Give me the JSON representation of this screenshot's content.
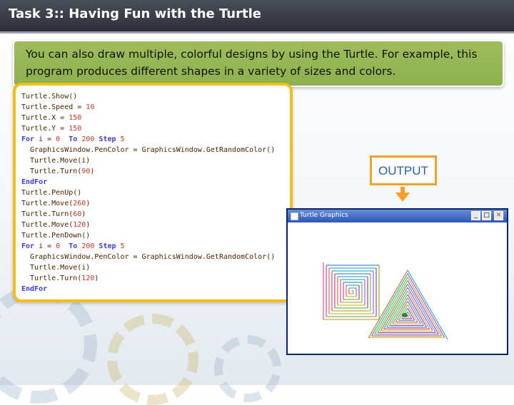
{
  "slide": {
    "title": "Task 3:: Having Fun with the Turtle",
    "instruction": "You can also draw multiple, colorful designs by using the Turtle.  For example, this program produces different shapes in a variety of sizes and colors."
  },
  "code": {
    "lines": [
      "Turtle.Show()",
      "Turtle.Speed = 10",
      "Turtle.X = 150",
      "Turtle.Y = 150",
      "For i = 0  To 200 Step 5",
      "  GraphicsWindow.PenColor = GraphicsWindow.GetRandomColor()",
      "  Turtle.Move(i)",
      "  Turtle.Turn(90)",
      "EndFor",
      "Turtle.PenUp()",
      "Turtle.Move(260)",
      "Turtle.Turn(60)",
      "Turtle.Move(120)",
      "Turtle.PenDown()",
      "For i = 0  To 200 Step 5",
      "  GraphicsWindow.PenColor = GraphicsWindow.GetRandomColor()",
      "  Turtle.Move(i)",
      "  Turtle.Turn(120)",
      "EndFor"
    ]
  },
  "output": {
    "label": "OUTPUT"
  },
  "turtle_window": {
    "title": "Turtle Graphics",
    "minimize_glyph": "_",
    "maximize_glyph": "□",
    "close_glyph": "✕"
  },
  "colors": {
    "title_bar": "#2d3038",
    "instruction_bg": "#9dbd5d",
    "code_border": "#f2be1e",
    "output_border": "#f2a126",
    "output_text": "#2a5fa8",
    "window_title_bar": "#2a57b8"
  },
  "icons": {
    "window_app": "window-icon",
    "turtle": "turtle-icon"
  }
}
